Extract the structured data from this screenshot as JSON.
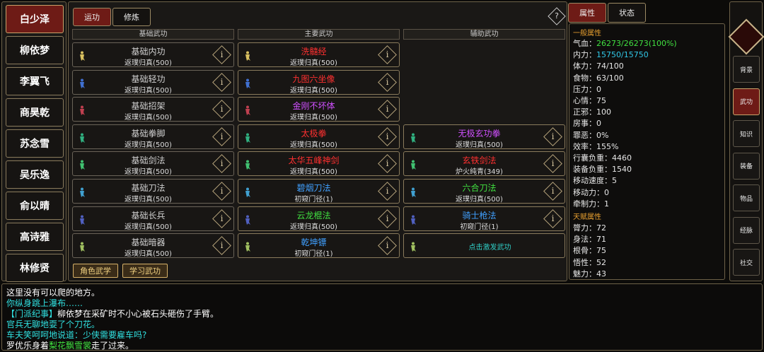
{
  "characters": [
    "白少泽",
    "柳依梦",
    "李翼飞",
    "商昊乾",
    "苏念雪",
    "吴乐逸",
    "俞以晴",
    "高诗雅",
    "林修贤"
  ],
  "main_tabs": [
    "运功",
    "修炼"
  ],
  "help_symbol": "?",
  "columns": [
    "基础武功",
    "主要武功",
    "辅助武功"
  ],
  "basic": [
    {
      "name": "基础内功",
      "level": "返璞归真(500)"
    },
    {
      "name": "基础轻功",
      "level": "返璞归真(500)"
    },
    {
      "name": "基础招架",
      "level": "返璞归真(500)"
    },
    {
      "name": "基础拳脚",
      "level": "返璞归真(500)"
    },
    {
      "name": "基础剑法",
      "level": "返璞归真(500)"
    },
    {
      "name": "基础刀法",
      "level": "返璞归真(500)"
    },
    {
      "name": "基础长兵",
      "level": "返璞归真(500)"
    },
    {
      "name": "基础暗器",
      "level": "返璞归真(500)"
    }
  ],
  "major": [
    {
      "name": "洗髓经",
      "level": "返璞归真(500)",
      "color": "#ff3030"
    },
    {
      "name": "九图六坐像",
      "level": "返璞归真(500)",
      "color": "#ff3030"
    },
    {
      "name": "金刚不坏体",
      "level": "返璞归真(500)",
      "color": "#d050ff"
    },
    {
      "name": "太极拳",
      "level": "返璞归真(500)",
      "color": "#ff3030"
    },
    {
      "name": "太华五峰神剑",
      "level": "返璞归真(500)",
      "color": "#ff3030"
    },
    {
      "name": "碧烟刀法",
      "level": "初窥门径(1)",
      "color": "#40a0ff"
    },
    {
      "name": "云龙棍法",
      "level": "返璞归真(500)",
      "color": "#40e040"
    },
    {
      "name": "乾坤镖",
      "level": "初窥门径(1)",
      "color": "#40a0ff"
    }
  ],
  "aux": [
    {
      "name": "无极玄功拳",
      "level": "返璞归真(500)",
      "color": "#d050ff"
    },
    {
      "name": "玄铁剑法",
      "level": "炉火纯青(349)",
      "color": "#ff3030"
    },
    {
      "name": "六合刀法",
      "level": "返璞归真(500)",
      "color": "#40e040"
    },
    {
      "name": "骑士枪法",
      "level": "初窥门径(1)",
      "color": "#40a0ff"
    }
  ],
  "aux_hint": "点击激发武功",
  "info_symbol": "i",
  "bottom_buttons": [
    "角色武学",
    "学习武功"
  ],
  "attr_tabs": [
    "属性",
    "状态"
  ],
  "general_header": "一般属性",
  "general": [
    {
      "label": "气血：",
      "value": "26273/26273(100%)",
      "color": "#40e040"
    },
    {
      "label": "内力：",
      "value": "15750/15750",
      "color": "#30c8e8"
    },
    {
      "label": "体力：",
      "value": "74/100"
    },
    {
      "label": "食物：",
      "value": "63/100"
    },
    {
      "label": "压力：",
      "value": "0"
    },
    {
      "label": "心情：",
      "value": "75"
    },
    {
      "label": "正邪：",
      "value": "100"
    },
    {
      "label": "房事：",
      "value": "0"
    },
    {
      "label": "罪恶：",
      "value": "0%"
    },
    {
      "label": "效率：",
      "value": "155%"
    },
    {
      "label": "行囊负重：",
      "value": "4460"
    },
    {
      "label": "装备负重：",
      "value": "1540"
    },
    {
      "label": "移动速度：",
      "value": "5"
    },
    {
      "label": "移动力：",
      "value": "0"
    },
    {
      "label": "牵制力：",
      "value": "1"
    }
  ],
  "talent_header": "天赋属性",
  "talent": [
    {
      "label": "膂力：",
      "value": "72"
    },
    {
      "label": "身法：",
      "value": "71"
    },
    {
      "label": "根骨：",
      "value": "75"
    },
    {
      "label": "悟性：",
      "value": "52"
    },
    {
      "label": "魅力：",
      "value": "43"
    }
  ],
  "side_menu": [
    "背景",
    "武功",
    "知识",
    "装备",
    "物品",
    "经脉",
    "社交"
  ],
  "log": [
    {
      "parts": [
        {
          "t": "这里没有可以爬的地方。",
          "c": "#ffffff"
        }
      ]
    },
    {
      "parts": [
        {
          "t": "你纵身跳上瀑布……",
          "c": "#30e0e0"
        }
      ]
    },
    {
      "parts": [
        {
          "t": "【门派纪事】",
          "c": "#30e0e0"
        },
        {
          "t": "柳依梦在采矿时不小心被石头砸伤了手臂。",
          "c": "#ffffff"
        }
      ]
    },
    {
      "parts": [
        {
          "t": "官兵无聊地耍了个刀花。",
          "c": "#30e0e0"
        }
      ]
    },
    {
      "parts": [
        {
          "t": "车夫笑呵呵地说道：少侠需要雇车吗?",
          "c": "#30e0e0"
        }
      ]
    },
    {
      "parts": [
        {
          "t": "罗优乐身着",
          "c": "#ffffff"
        },
        {
          "t": "梨花飘雪裳",
          "c": "#40e040"
        },
        {
          "t": "走了过来。",
          "c": "#ffffff"
        }
      ]
    }
  ]
}
